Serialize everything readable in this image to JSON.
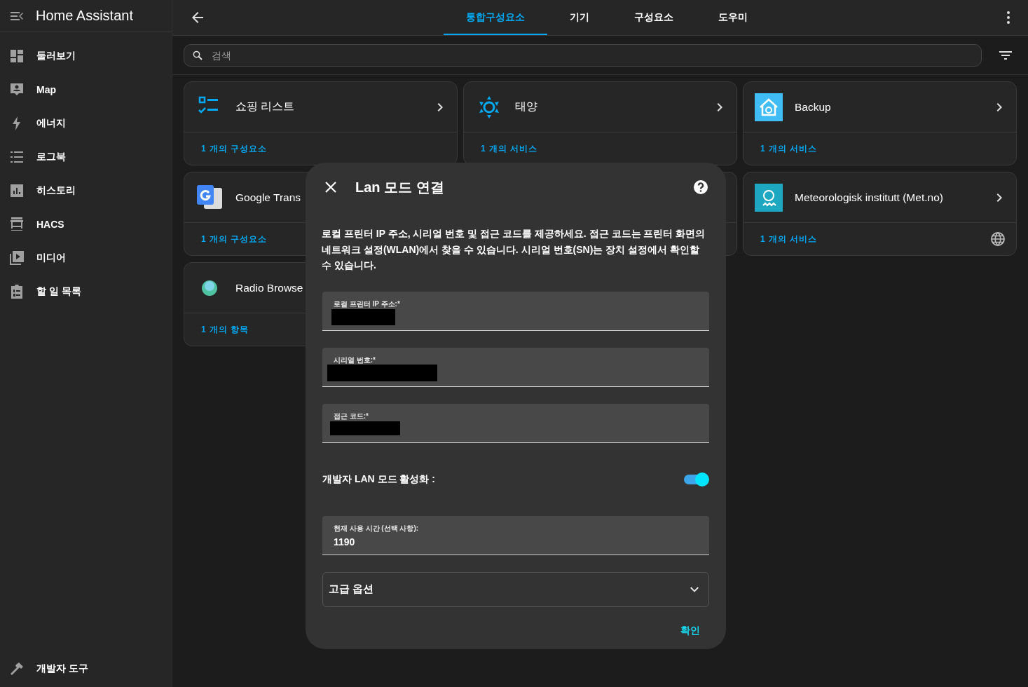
{
  "sidebar": {
    "title": "Home Assistant",
    "items": [
      {
        "label": "둘러보기"
      },
      {
        "label": "Map"
      },
      {
        "label": "에너지"
      },
      {
        "label": "로그북"
      },
      {
        "label": "히스토리"
      },
      {
        "label": "HACS"
      },
      {
        "label": "미디어"
      },
      {
        "label": "할 일 목록"
      }
    ],
    "bottom_item": {
      "label": "개발자 도구"
    }
  },
  "tabs": [
    {
      "label": "통합구성요소",
      "selected": true
    },
    {
      "label": "기기",
      "selected": false
    },
    {
      "label": "구성요소",
      "selected": false
    },
    {
      "label": "도우미",
      "selected": false
    }
  ],
  "search": {
    "placeholder": "검색"
  },
  "integrations": [
    {
      "kind": "card",
      "title": "쇼핑 리스트",
      "link": "1 개의 구성요소"
    },
    {
      "kind": "card",
      "title": "태양",
      "link": "1 개의 서비스"
    },
    {
      "kind": "card",
      "title": "Backup",
      "link": "1 개의 서비스"
    },
    {
      "kind": "card",
      "title": "Google Trans",
      "link": "1 개의 구성요소"
    },
    {
      "kind": "covered"
    },
    {
      "kind": "card",
      "title": "Meteorologisk institutt (Met.no)",
      "link": "1 개의 서비스",
      "cloud": true
    },
    {
      "kind": "card",
      "title": "Radio Browse",
      "link": "1 개의 항목"
    }
  ],
  "dialog": {
    "title": "Lan 모드 연결",
    "description": "로컬 프린터 IP 주소, 시리얼 번호 및 접근 코드를 제공하세요. 접근 코드는 프린터 화면의 네트워크 설정(WLAN)에서 찾을 수 있습니다. 시리얼 번호(SN)는 장치 설정에서 확인할 수 있습니다.",
    "fields": [
      {
        "kind": "text_field",
        "label": "로컬 프린터 IP 주소:*",
        "redacted": true
      },
      {
        "kind": "text_field",
        "label": "시리얼 번호:*",
        "redacted": true
      },
      {
        "kind": "text_field",
        "label": "접근 코드:*",
        "redacted": true
      },
      {
        "kind": "switch",
        "label": "개발자 LAN 모드 활성화 :",
        "on": true
      },
      {
        "kind": "text_field",
        "label": "현재 사용 시간 (선택 사항):",
        "value": "1190"
      },
      {
        "kind": "expander",
        "label": "고급 옵션",
        "expanded": false
      }
    ],
    "button": "확인"
  }
}
